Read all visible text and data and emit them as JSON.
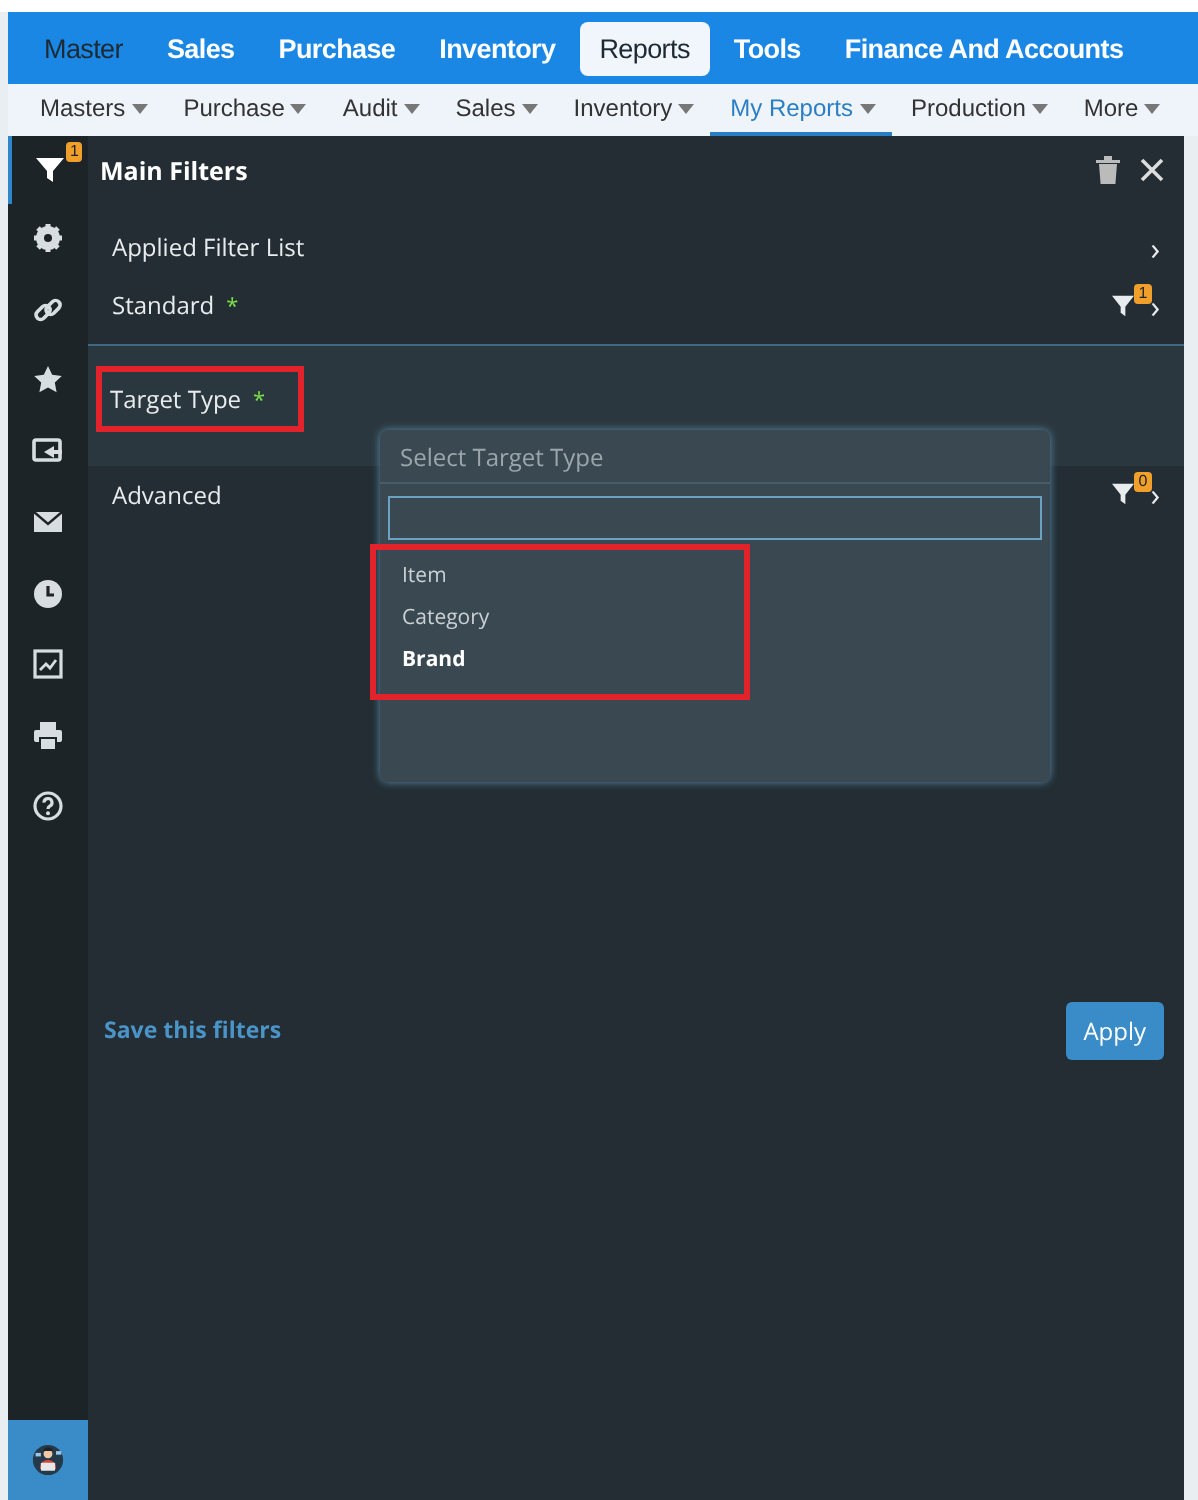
{
  "main_nav": [
    {
      "label": "Master",
      "selected": false
    },
    {
      "label": "Sales",
      "selected": false
    },
    {
      "label": "Purchase",
      "selected": false
    },
    {
      "label": "Inventory",
      "selected": false
    },
    {
      "label": "Reports",
      "selected": true
    },
    {
      "label": "Tools",
      "selected": false
    },
    {
      "label": "Finance And Accounts",
      "selected": false
    }
  ],
  "sub_nav": [
    {
      "label": "Masters",
      "selected": false
    },
    {
      "label": "Purchase",
      "selected": false
    },
    {
      "label": "Audit",
      "selected": false
    },
    {
      "label": "Sales",
      "selected": false
    },
    {
      "label": "Inventory",
      "selected": false
    },
    {
      "label": "My Reports",
      "selected": true
    },
    {
      "label": "Production",
      "selected": false
    },
    {
      "label": "More",
      "selected": false
    }
  ],
  "panel": {
    "title": "Main Filters",
    "filter_badge": "1"
  },
  "sidebar_icons": [
    {
      "kind": "gear"
    },
    {
      "kind": "link"
    },
    {
      "kind": "star"
    },
    {
      "kind": "share"
    },
    {
      "kind": "mail"
    },
    {
      "kind": "clock"
    },
    {
      "kind": "chart"
    },
    {
      "kind": "print"
    },
    {
      "kind": "help"
    }
  ],
  "rows": [
    {
      "label": "Applied Filter List",
      "chevron": "›"
    },
    {
      "label": "Standard",
      "required_mark": "*",
      "badge": "1",
      "chevron": "›"
    }
  ],
  "target_type": {
    "label": "Target Type",
    "required_mark": "*",
    "highlighted": true
  },
  "advanced": {
    "label": "Advanced",
    "badge": "0",
    "chevron": "›"
  },
  "dropdown": {
    "placeholder": "Select Target Type",
    "options_highlighted": true,
    "options": [
      {
        "label": "Item",
        "selected": false
      },
      {
        "label": "Category",
        "selected": false
      },
      {
        "label": "Brand",
        "selected": true
      }
    ]
  },
  "save_link": "Save this filters",
  "apply_button": "Apply"
}
